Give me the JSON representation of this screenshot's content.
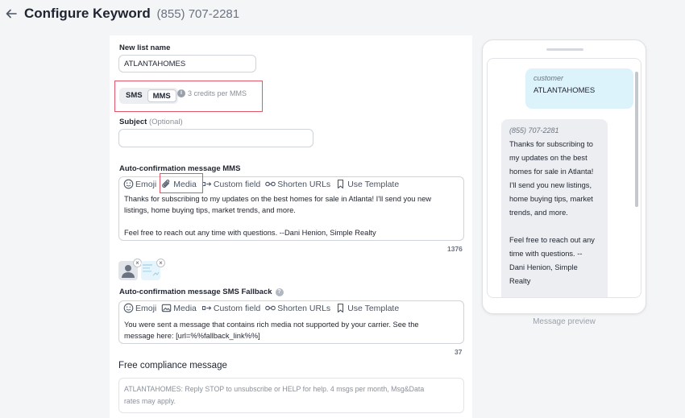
{
  "header": {
    "title": "Configure Keyword",
    "phone": "(855) 707-2281"
  },
  "form": {
    "list_name_label": "New list name",
    "list_name_value": "ATLANTAHOMES",
    "msg_type": {
      "sms": "SMS",
      "mms": "MMS",
      "selected": "MMS",
      "credits": "3 credits per MMS"
    },
    "subject_label": "Subject",
    "subject_optional": "(Optional)",
    "subject_value": "",
    "mms_label": "Auto-confirmation message MMS",
    "toolbar": {
      "emoji": "Emoji",
      "media": "Media",
      "custom_field": "Custom field",
      "shorten_urls": "Shorten URLs",
      "use_template": "Use Template"
    },
    "mms_body_line1": "Thanks for subscribing to my updates on the best homes for sale in Atlanta! I'll send you new",
    "mms_body_line2": "listings, home buying tips, market trends, and more.",
    "mms_body_line3": "Feel free to reach out any time with questions. --Dani Henion, Simple Realty",
    "mms_counter": "1376",
    "fallback_label": "Auto-confirmation message SMS Fallback",
    "fallback_body_line1": "You were sent a message that contains rich media not supported by your carrier. See the",
    "fallback_body_line2": "message here: [url=%%fallback_link%%]",
    "fallback_counter": "37",
    "compliance_label": "Free compliance message",
    "compliance_line1": "ATLANTAHOMES: Reply STOP to unsubscribe or HELP for help. 4 msgs per month, Msg&Data",
    "compliance_line2": "rates may apply."
  },
  "preview": {
    "out_sender": "customer",
    "out_message": "ATLANTAHOMES",
    "in_sender": "(855) 707-2281",
    "in_lines": [
      "Thanks for subscribing to",
      "my updates on the best",
      "homes for sale in Atlanta!",
      "I'll send you new listings,",
      "home buying tips, market",
      "trends, and more.",
      "",
      "Feel free to reach out any",
      "time with questions. --",
      "Dani Henion, Simple",
      "Realty"
    ],
    "caption": "Message preview"
  },
  "colors": {
    "highlight": "#e0566b",
    "bubble_out": "#dcf3fb",
    "bubble_in": "#eceef1"
  }
}
